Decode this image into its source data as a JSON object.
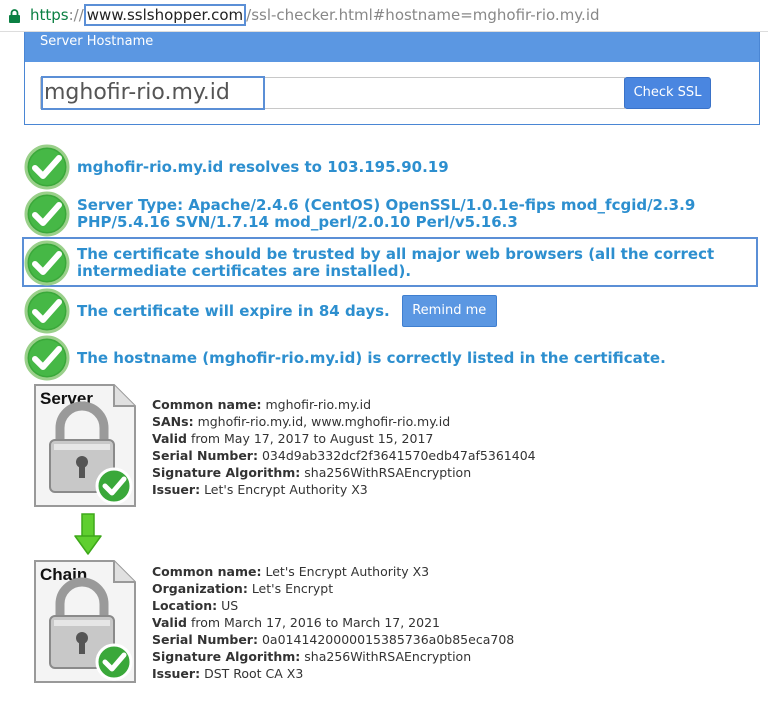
{
  "browser": {
    "url_scheme": "https",
    "url_sep": "://",
    "url_host": "www.sslshopper.com",
    "url_path": "/ssl-checker.html#hostname=mghofir-rio.my.id",
    "secure_color": "#0b8043"
  },
  "form": {
    "panel_title": "Server Hostname",
    "hostname_value": "mghofir-rio.my.id",
    "check_button": "Check SSL"
  },
  "results": [
    {
      "icon": "check-icon",
      "text": "mghofir-rio.my.id resolves to 103.195.90.19"
    },
    {
      "icon": "check-icon",
      "text": "Server Type: Apache/2.4.6 (CentOS) OpenSSL/1.0.1e-fips mod_fcgid/2.3.9 PHP/5.4.16 SVN/1.7.14 mod_perl/2.0.10 Perl/v5.16.3"
    },
    {
      "icon": "check-icon",
      "text": "The certificate should be trusted by all major web browsers (all the correct intermediate certificates are installed)."
    },
    {
      "icon": "check-icon",
      "text": "The certificate will expire in 84 days.",
      "button": "Remind me"
    },
    {
      "icon": "check-icon",
      "text": "The hostname (mghofir-rio.my.id) is correctly listed in the certificate."
    }
  ],
  "server_cert": {
    "icon_label": "Server",
    "fields": [
      {
        "label": "Common name:",
        "value": "mghofir-rio.my.id"
      },
      {
        "label": "SANs:",
        "value": "mghofir-rio.my.id, www.mghofir-rio.my.id"
      },
      {
        "label": "Valid",
        "value": "from May 17, 2017 to August 15, 2017"
      },
      {
        "label": "Serial Number:",
        "value": "034d9ab332dcf2f3641570edb47af5361404"
      },
      {
        "label": "Signature Algorithm:",
        "value": "sha256WithRSAEncryption"
      },
      {
        "label": "Issuer:",
        "value": "Let's Encrypt Authority X3"
      }
    ]
  },
  "chain_cert": {
    "icon_label": "Chain",
    "fields": [
      {
        "label": "Common name:",
        "value": "Let's Encrypt Authority X3"
      },
      {
        "label": "Organization:",
        "value": "Let's Encrypt"
      },
      {
        "label": "Location:",
        "value": "US"
      },
      {
        "label": "Valid",
        "value": "from March 17, 2016 to March 17, 2021"
      },
      {
        "label": "Serial Number:",
        "value": "0a0141420000015385736a0b85eca708"
      },
      {
        "label": "Signature Algorithm:",
        "value": "sha256WithRSAEncryption"
      },
      {
        "label": "Issuer:",
        "value": "DST Root CA X3"
      }
    ]
  },
  "colors": {
    "accent_blue": "#5b97e2",
    "result_text": "#2d8fcf",
    "check_green": "#3aa83a",
    "arrow_green": "#5fcf2f"
  }
}
